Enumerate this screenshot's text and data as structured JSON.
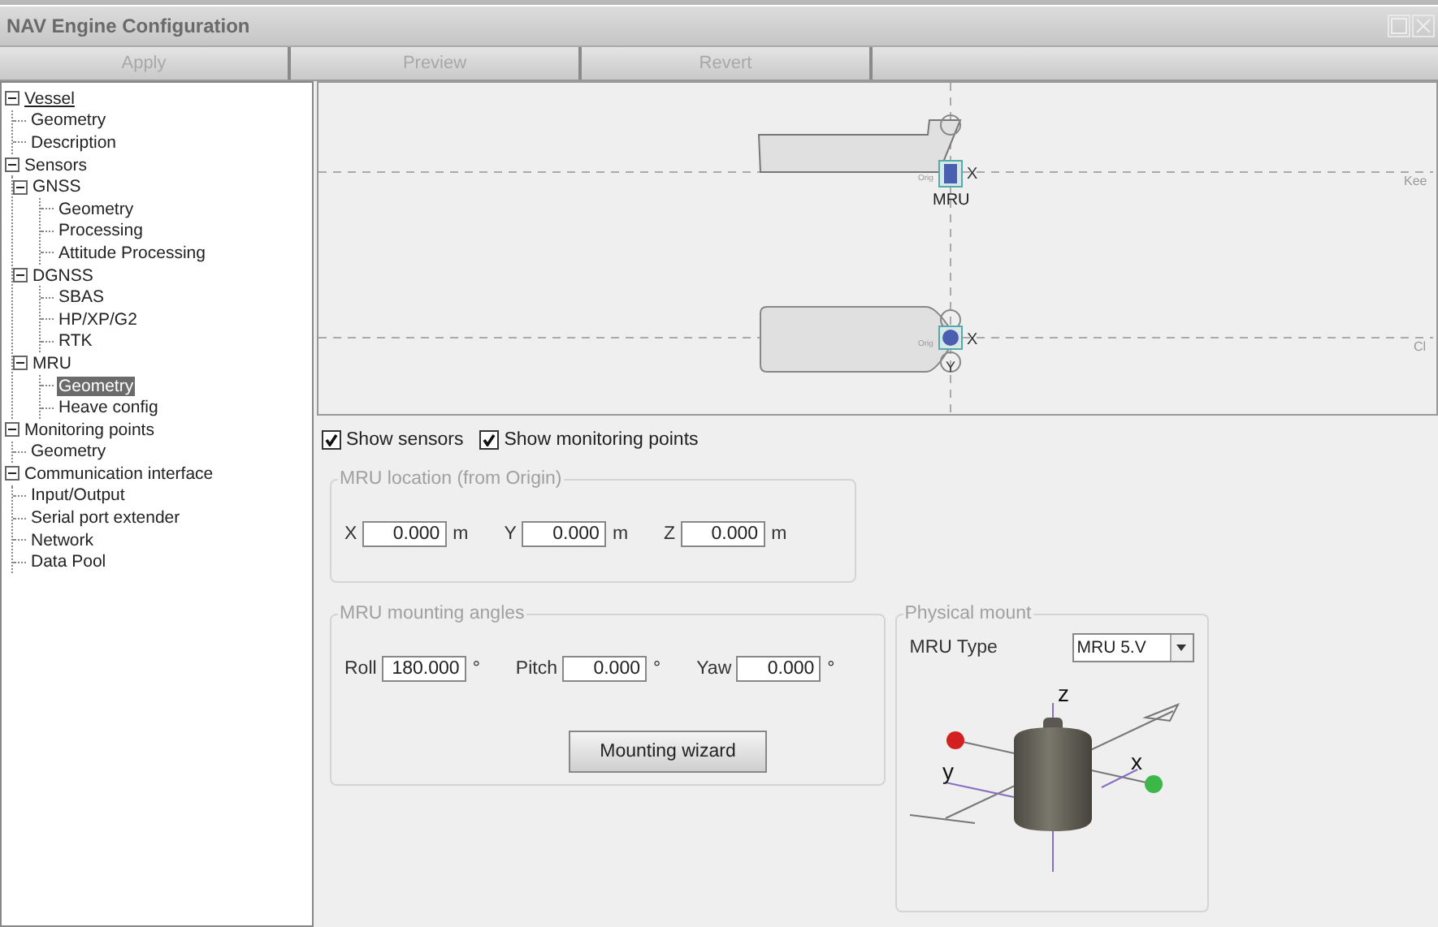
{
  "window": {
    "title": "NAV Engine Configuration"
  },
  "toolbar": [
    {
      "label": "Apply",
      "disabled": true
    },
    {
      "label": "Preview",
      "disabled": true
    },
    {
      "label": "Revert",
      "disabled": true
    }
  ],
  "tree": [
    {
      "label": "Vessel",
      "selected": false,
      "expanded": true,
      "children": [
        {
          "label": "Geometry",
          "selected": false
        },
        {
          "label": "Description",
          "selected": false
        }
      ]
    },
    {
      "label": "Sensors",
      "selected": false,
      "expanded": true,
      "children": [
        {
          "label": "GNSS",
          "selected": false,
          "expanded": true,
          "children": [
            {
              "label": "Geometry",
              "selected": false
            },
            {
              "label": "Processing",
              "selected": false
            },
            {
              "label": "Attitude Processing",
              "selected": false
            }
          ]
        },
        {
          "label": "DGNSS",
          "selected": false,
          "expanded": true,
          "children": [
            {
              "label": "SBAS",
              "selected": false
            },
            {
              "label": "HP/XP/G2",
              "selected": false
            },
            {
              "label": "RTK",
              "selected": false
            }
          ]
        },
        {
          "label": "MRU",
          "selected": false,
          "expanded": true,
          "children": [
            {
              "label": "Geometry",
              "selected": true
            },
            {
              "label": "Heave config",
              "selected": false
            }
          ]
        }
      ]
    },
    {
      "label": "Monitoring points",
      "selected": false,
      "expanded": true,
      "children": [
        {
          "label": "Geometry",
          "selected": false
        }
      ]
    },
    {
      "label": "Communication interface",
      "selected": false,
      "expanded": true,
      "children": [
        {
          "label": "Input/Output",
          "selected": false
        },
        {
          "label": "Serial port extender",
          "selected": false
        },
        {
          "label": "Network",
          "selected": false
        },
        {
          "label": "Data Pool",
          "selected": false
        }
      ]
    }
  ],
  "diagram": {
    "side_view": {
      "sensor_label": "MRU",
      "axis_label": "X",
      "origin_label": "Orig",
      "line_label": "Kee"
    },
    "top_view": {
      "axis_x_label": "X",
      "axis_y_label": "Y",
      "origin_label": "Orig",
      "line_label": "Cl"
    }
  },
  "options": [
    {
      "label": "Show sensors",
      "checked": true
    },
    {
      "label": "Show monitoring points",
      "checked": true
    }
  ],
  "location": {
    "title": "MRU location (from Origin)",
    "fields": [
      {
        "label": "X",
        "value": "0.000",
        "unit": "m"
      },
      {
        "label": "Y",
        "value": "0.000",
        "unit": "m"
      },
      {
        "label": "Z",
        "value": "0.000",
        "unit": "m"
      }
    ]
  },
  "angles": {
    "title": "MRU mounting angles",
    "fields": [
      {
        "label": "Roll",
        "value": "180.000",
        "unit": "°"
      },
      {
        "label": "Pitch",
        "value": "0.000",
        "unit": "°"
      },
      {
        "label": "Yaw",
        "value": "0.000",
        "unit": "°"
      }
    ],
    "button": "Mounting wizard"
  },
  "physical_mount": {
    "title": "Physical mount",
    "type_label": "MRU Type",
    "type_value": "MRU 5.V",
    "axis_labels": {
      "z": "z",
      "x": "x",
      "y": "y"
    }
  }
}
